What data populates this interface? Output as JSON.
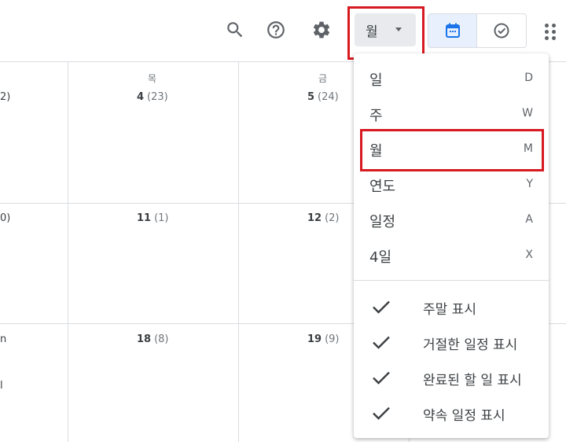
{
  "toolbar": {
    "search_icon": "search-icon",
    "help_icon": "help-icon",
    "settings_icon": "gear-icon",
    "view_selector_label": "월",
    "calendar_toggle_icon": "calendar-icon",
    "tasks_toggle_icon": "check-circle-icon",
    "apps_icon": "apps-grid-icon"
  },
  "calendar": {
    "weekdays": [
      "목",
      "금"
    ],
    "rows": [
      {
        "edge": "2)",
        "cells": [
          {
            "day": "4",
            "lunar": "(23)"
          },
          {
            "day": "5",
            "lunar": "(24)"
          }
        ]
      },
      {
        "edge": "0)",
        "cells": [
          {
            "day": "11",
            "lunar": "(1)"
          },
          {
            "day": "12",
            "lunar": "(2)"
          }
        ]
      },
      {
        "edge": "n",
        "cells": [
          {
            "day": "18",
            "lunar": "(8)"
          },
          {
            "day": "19",
            "lunar": "(9)"
          }
        ]
      }
    ],
    "edge_extra": "l"
  },
  "menu": {
    "items": [
      {
        "label": "일",
        "key": "D"
      },
      {
        "label": "주",
        "key": "W"
      },
      {
        "label": "월",
        "key": "M"
      },
      {
        "label": "연도",
        "key": "Y"
      },
      {
        "label": "일정",
        "key": "A"
      },
      {
        "label": "4일",
        "key": "X"
      }
    ],
    "options": [
      {
        "label": "주말 표시",
        "checked": true
      },
      {
        "label": "거절한 일정 표시",
        "checked": true
      },
      {
        "label": "완료된 할 일 표시",
        "checked": true
      },
      {
        "label": "약속 일정 표시",
        "checked": true
      }
    ]
  },
  "colors": {
    "accent": "#1a73e8",
    "highlight_box": "#d71920"
  }
}
